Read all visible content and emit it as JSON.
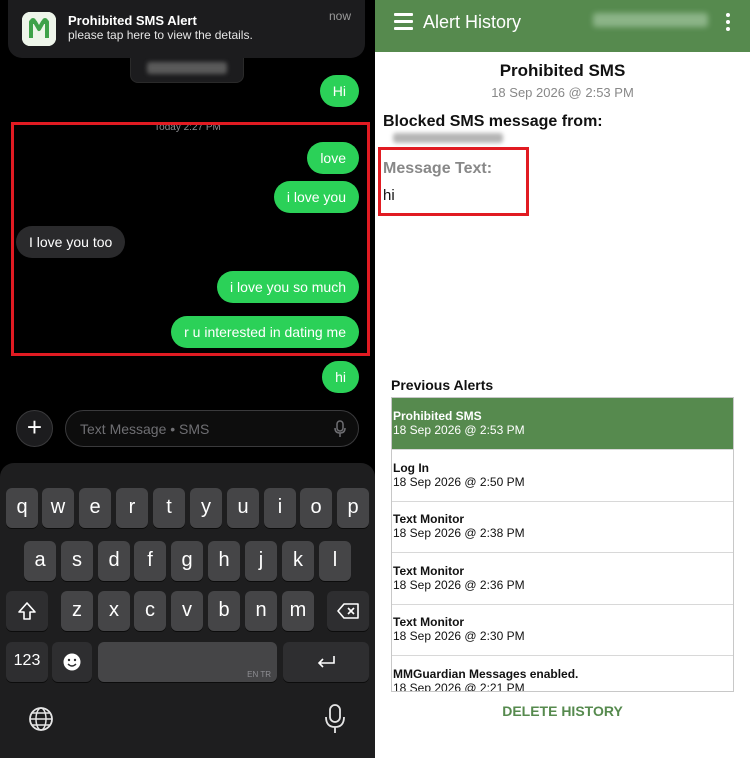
{
  "notification": {
    "title": "Prohibited SMS Alert",
    "body": "please tap here to view the details.",
    "time": "now"
  },
  "conversation": {
    "timestamp": "Today 2:27 PM",
    "messages": [
      {
        "text": "Hi",
        "side": "sent"
      },
      {
        "text": "love",
        "side": "sent"
      },
      {
        "text": "i love you",
        "side": "sent"
      },
      {
        "text": "I love you too",
        "side": "received"
      },
      {
        "text": "i love you so much",
        "side": "sent"
      },
      {
        "text": "r u interested in dating me",
        "side": "sent"
      },
      {
        "text": "hi",
        "side": "sent"
      }
    ]
  },
  "composer": {
    "placeholder": "Text Message • SMS"
  },
  "keyboard": {
    "row1": [
      "q",
      "w",
      "e",
      "r",
      "t",
      "y",
      "u",
      "i",
      "o",
      "p"
    ],
    "row2": [
      "a",
      "s",
      "d",
      "f",
      "g",
      "h",
      "j",
      "k",
      "l"
    ],
    "row3": [
      "z",
      "x",
      "c",
      "v",
      "b",
      "n",
      "m"
    ],
    "numbers_key": "123",
    "language_hint": "EN TR"
  },
  "app": {
    "title": "Alert History",
    "accent_color": "#568a4e",
    "alert": {
      "title": "Prohibited SMS",
      "date": "18 Sep 2026 @ 2:53 PM",
      "blocked_from_label": "Blocked SMS message from:",
      "message_text_label": "Message Text:",
      "message_text_value": "hi"
    },
    "previous_alerts_label": "Previous Alerts",
    "previous_alerts": [
      {
        "title": "Prohibited SMS",
        "date": "18 Sep 2026 @ 2:53 PM",
        "selected": true
      },
      {
        "title": "Log In",
        "date": "18 Sep 2026 @ 2:50 PM",
        "selected": false
      },
      {
        "title": "Text Monitor",
        "date": "18 Sep 2026 @ 2:38 PM",
        "selected": false
      },
      {
        "title": "Text Monitor",
        "date": "18 Sep 2026 @ 2:36 PM",
        "selected": false
      },
      {
        "title": "Text Monitor",
        "date": "18 Sep 2026 @ 2:30 PM",
        "selected": false
      },
      {
        "title": "MMGuardian Messages enabled.",
        "date": "18 Sep 2026 @ 2:21 PM",
        "selected": false
      }
    ],
    "delete_label": "DELETE HISTORY"
  }
}
